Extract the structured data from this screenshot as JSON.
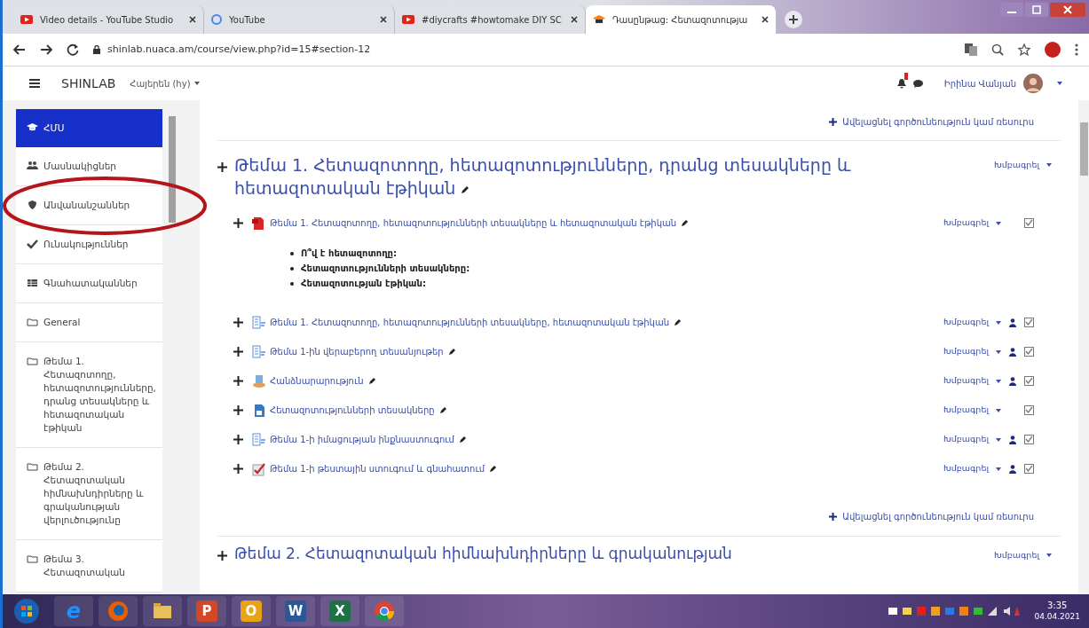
{
  "browser": {
    "tabs": [
      {
        "title": "Video details - YouTube Studio",
        "kind": "video",
        "selected": false
      },
      {
        "title": "YouTube",
        "kind": "letter",
        "selected": false
      },
      {
        "title": "#diycrafts #howtomake DIY SC",
        "kind": "video",
        "selected": false
      },
      {
        "title": "Դասընթաց: Հետազոտությա",
        "kind": "cap",
        "selected": true
      }
    ],
    "url": "shinlab.nuaca.am/course/view.php?id=15#section-12"
  },
  "navbar": {
    "site": "SHINLAB",
    "language": "Հայերեն (hy)",
    "user": "Իրինա Վանյան",
    "notification_badge": true
  },
  "sidebar": {
    "items": [
      {
        "label": "ՀՄՍ",
        "kind": "cap",
        "selected": true
      },
      {
        "label": "Մասնակիցներ",
        "kind": "users",
        "selected": false
      },
      {
        "label": "Անվանանշաններ",
        "kind": "shield",
        "selected": false
      },
      {
        "label": "Ունակություններ",
        "kind": "check",
        "selected": false
      },
      {
        "label": "Գնահատականներ",
        "kind": "table",
        "selected": false
      },
      {
        "label": "General",
        "kind": "folder",
        "selected": false
      },
      {
        "label": "Թեմա 1. Հետազոտողը, հետազոտությունները, դրանց տեսակները և հետազոտական էթիկան",
        "kind": "folder",
        "selected": false
      },
      {
        "label": "Թեմա 2. Հետազոտական հիմնախնդիրները և գրականության վերլուծությունը",
        "kind": "folder",
        "selected": false
      },
      {
        "label": "Թեմա 3. Հետազոտական",
        "kind": "folder",
        "selected": false
      }
    ]
  },
  "main": {
    "top_add_link": "Ավելացնել գործունեություն կամ ռեսուրս",
    "section": {
      "title": "Թեմա 1. Հետազոտողը, հետազոտությունները, դրանց տեսակները և հետազոտական էթիկան",
      "edit_label": "Խմբագրել",
      "activities": [
        {
          "kind": "pdf",
          "title": "Թեմա 1. Հետազոտողը, հետազոտությունների տեսակները և հետազոտական էթիկան",
          "edit_label": "Խմբագրել",
          "role_icon": false,
          "summary": [
            "Ո՞վ է հետազոտողը:",
            "Հետազոտությունների տեսակները:",
            "Հետազոտության էթիկան:"
          ]
        },
        {
          "kind": "page",
          "title": "Թեմա 1. Հետազոտողը, հետազոտությունների տեսակները, հետազոտական էթիկան",
          "edit_label": "Խմբագրել",
          "role_icon": true
        },
        {
          "kind": "page",
          "title": "Թեմա 1-ին վերաբերող տեսանյութեր",
          "edit_label": "Խմբագրել",
          "role_icon": true
        },
        {
          "kind": "assign",
          "title": "Հանձնարարություն",
          "edit_label": "Խմբագրել",
          "role_icon": true
        },
        {
          "kind": "file",
          "title": "Հետազոտությունների տեսակները",
          "edit_label": "Խմբագրել",
          "role_icon": false
        },
        {
          "kind": "page",
          "title": "Թեմա 1-ի իմացության ինքնաստուգում",
          "edit_label": "Խմբագրել",
          "role_icon": true
        },
        {
          "kind": "quiz",
          "title": "Թեմա 1-ի թեստային ստուգում և գնահատում",
          "edit_label": "Խմբագրել",
          "role_icon": true
        }
      ],
      "add_link": "Ավելացնել գործունեություն կամ ռեսուրս"
    },
    "next_section": {
      "title": "Թեմա 2. Հետազոտական հիմնախնդիրները և գրականության",
      "edit_label": "Խմբագրել"
    }
  },
  "taskbar": {
    "apps": [
      {
        "kind": "ie",
        "glyph": "e"
      },
      {
        "kind": "firefox"
      },
      {
        "kind": "explorer"
      },
      {
        "kind": "square",
        "glyph": "P",
        "color": "#d24726"
      },
      {
        "kind": "square",
        "glyph": "O",
        "color": "#e8a317"
      },
      {
        "kind": "square",
        "glyph": "W",
        "color": "#2b5797"
      },
      {
        "kind": "square",
        "glyph": "X",
        "color": "#1e7145"
      },
      {
        "kind": "chrome"
      }
    ],
    "time": "3:35",
    "date": "04.04.2021"
  }
}
